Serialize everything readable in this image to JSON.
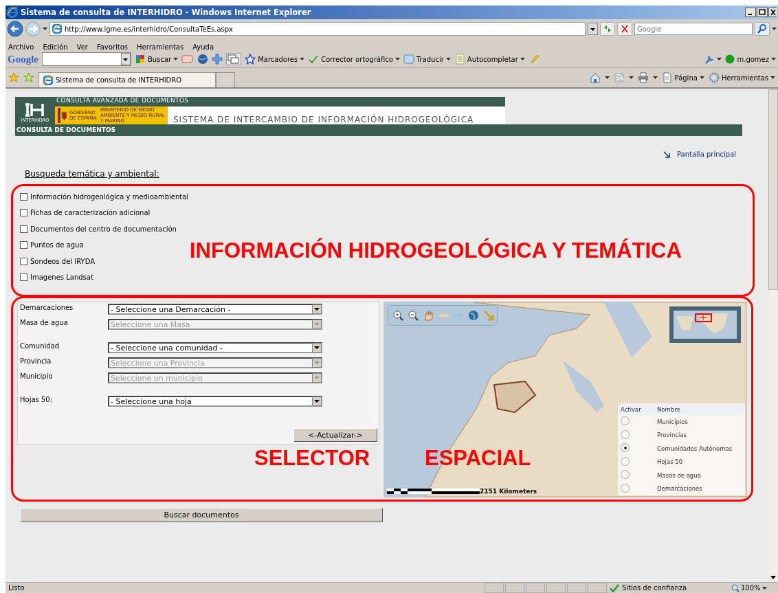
{
  "window": {
    "title": "Sistema de consulta de INTERHIDRO - Windows Internet Explorer"
  },
  "address_bar": {
    "url": "http://www.igme.es/interhidro/ConsultaTeEs.aspx",
    "search_placeholder": "Google"
  },
  "menu": [
    "Archivo",
    "Edición",
    "Ver",
    "Favoritos",
    "Herramientas",
    "Ayuda"
  ],
  "google_toolbar": {
    "logo": "Google",
    "buttons": [
      "Buscar",
      "Marcadores",
      "Corrector ortográfico",
      "Traducir",
      "Autocompletar"
    ],
    "user": "m.gomez"
  },
  "tab": {
    "label": "Sistema de consulta de INTERHIDRO"
  },
  "command_bar": [
    "Página",
    "Herramientas"
  ],
  "page": {
    "banner": {
      "top_title": "CONSULTA AVANZADA DE DOCUMENTOS",
      "logo_text": "INTERHIDRO",
      "gov_text": "GOBIERNO DE ESPAÑA",
      "ministry_text": "MINISTERIO DE MEDIO AMBIENTE Y MEDIO RURAL Y MARINO",
      "system_title": "SISTEMA DE INTERCAMBIO DE INFORMACIÓN HIDROGEOLÓGICA"
    },
    "section_title": "CONSULTA DE DOCUMENTOS",
    "home_link": "Pantalla principal",
    "search_heading": "Busqueda temática y ambiental:",
    "checkboxes": [
      {
        "label": "Información hidrogeológica y medioambiental",
        "checked": false
      },
      {
        "label": "Fichas de caracterización adicional",
        "checked": false
      },
      {
        "label": "Documentos del centro de documentación",
        "checked": false
      },
      {
        "label": "Puntos de agua",
        "checked": false
      },
      {
        "label": "Sondeos del IRYDA",
        "checked": false
      },
      {
        "label": "Imagenes Landsat",
        "checked": false
      }
    ],
    "filter_groups": [
      [
        {
          "label": "Demarcaciones",
          "value": "- Seleccione una Demarcación -",
          "disabled": false
        },
        {
          "label": "Masa de agua",
          "value": "Seleccione una Masa",
          "disabled": true
        }
      ],
      [
        {
          "label": "Comunidad",
          "value": "- Seleccione una comunidad -",
          "disabled": false
        },
        {
          "label": "Provincia",
          "value": "Seleccione una Provincia",
          "disabled": true
        },
        {
          "label": "Municipio",
          "value": "Seleccione un municipio",
          "disabled": true
        }
      ],
      [
        {
          "label": "Hojas 50:",
          "value": "- Seleccione una hoja",
          "disabled": false
        }
      ]
    ],
    "update_button": "<-Actualizar->",
    "map": {
      "layers_header": [
        "Activar",
        "Nombre"
      ],
      "layers": [
        {
          "name": "Municipios",
          "selected": false
        },
        {
          "name": "Provincias",
          "selected": false
        },
        {
          "name": "Comunidades Autónomas",
          "selected": true
        },
        {
          "name": "Hojas 50",
          "selected": false
        },
        {
          "name": "Masas de agua",
          "selected": false
        },
        {
          "name": "Demarcaciones",
          "selected": false
        }
      ],
      "scale": "2151 Kilometers"
    },
    "search_button": "Buscar documentos"
  },
  "annotations": [
    {
      "kind": "box",
      "text": "INFORMACIÓN HIDROGEOLÓGICA Y TEMÁTICA"
    },
    {
      "kind": "box",
      "text": "SELECTOR"
    },
    {
      "kind": "label",
      "text": "ESPACIAL"
    }
  ],
  "status_bar": {
    "text": "Listo",
    "zone": "Sitios de confianza",
    "zoom": "100%"
  }
}
